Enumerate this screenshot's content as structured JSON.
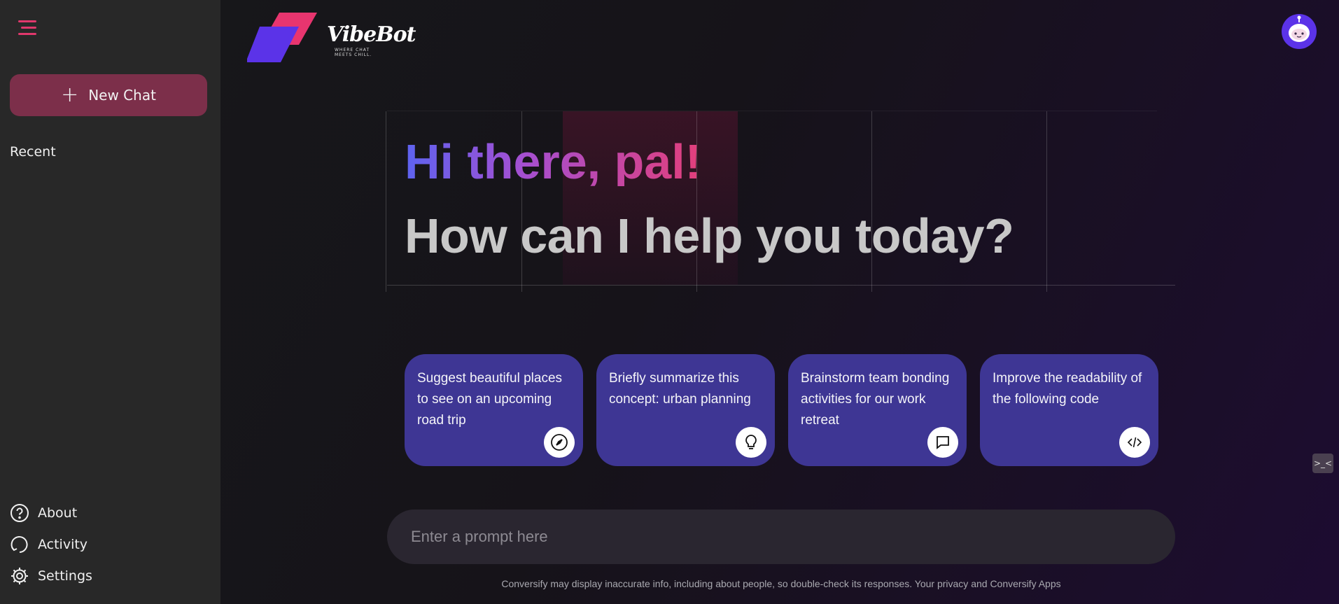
{
  "sidebar": {
    "new_chat_label": "New Chat",
    "recent_label": "Recent",
    "nav": [
      {
        "label": "About",
        "icon": "help-circle-icon"
      },
      {
        "label": "Activity",
        "icon": "history-icon"
      },
      {
        "label": "Settings",
        "icon": "gear-icon"
      }
    ]
  },
  "header": {
    "logo_text": "VibeBot",
    "logo_tagline": "WHERE CHAT MEETS CHILL."
  },
  "hero": {
    "greeting": "Hi there, pal!",
    "subtitle": "How can I help you today?"
  },
  "cards": [
    {
      "text": "Suggest beautiful places to see on an upcoming road trip",
      "icon": "compass-icon"
    },
    {
      "text": "Briefly summarize this concept: urban planning",
      "icon": "lightbulb-icon"
    },
    {
      "text": "Brainstorm team bonding activities for our work retreat",
      "icon": "chat-bubble-icon"
    },
    {
      "text": "Improve the readability of the following code",
      "icon": "code-icon"
    }
  ],
  "prompt": {
    "placeholder": "Enter a prompt here"
  },
  "footer": {
    "disclaimer": "Conversify may display inaccurate info, including about people, so double-check its responses. Your privacy and Conversify Apps"
  },
  "colors": {
    "sidebar_bg": "#282828",
    "accent": "#e0386c",
    "new_chat_bg": "#7c2f4a",
    "card_bg": "#3e3694",
    "prompt_bg": "#2a2630"
  }
}
